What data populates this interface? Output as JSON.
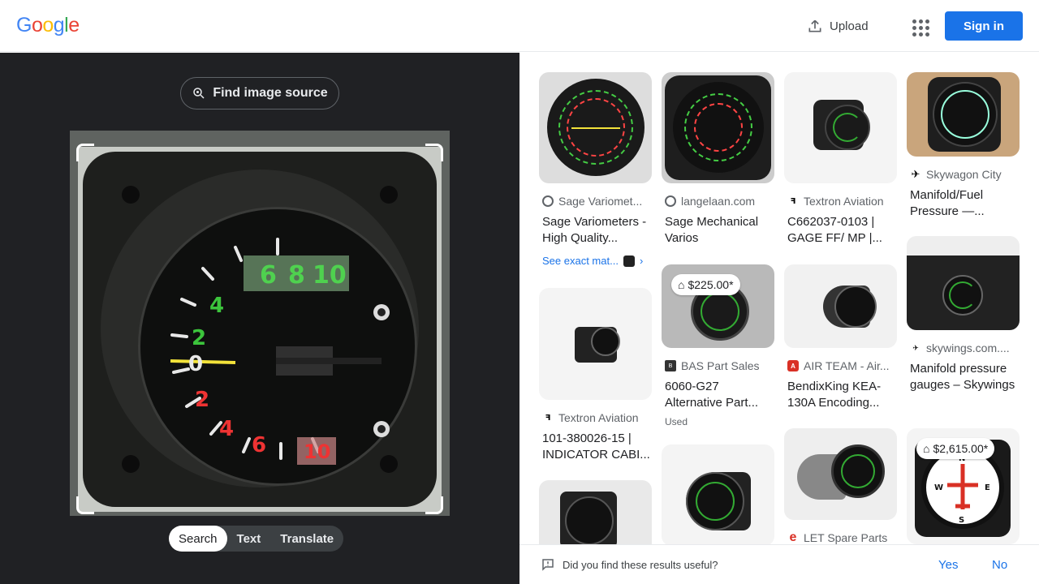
{
  "header": {
    "logo_letters": [
      "G",
      "o",
      "o",
      "g",
      "l",
      "e"
    ],
    "upload_label": "Upload",
    "signin_label": "Sign in"
  },
  "left": {
    "find_source_label": "Find image source",
    "chips": [
      "Search",
      "Text",
      "Translate"
    ],
    "active_chip": "Search"
  },
  "results": [
    {
      "source": "Sage Variomet...",
      "title": "Sage Variometers - High Quality...",
      "extra": "See exact mat..."
    },
    {
      "source": "langelaan.com",
      "title": "Sage Mechanical Varios"
    },
    {
      "source": "Textron Aviation",
      "title": "C662037-0103 | GAGE FF/ MP |..."
    },
    {
      "source": "Skywagon City",
      "title": "Manifold/Fuel Pressure —..."
    },
    {
      "source": "Textron Aviation",
      "title": "101-380026-15 | INDICATOR CABI..."
    },
    {
      "price": "$225.00*",
      "source": "BAS Part Sales",
      "title": "6060-G27 Alternative Part...",
      "extra": "Used"
    },
    {
      "source": "AIR TEAM - Air...",
      "title": "BendixKing KEA-130A Encoding..."
    },
    {
      "source": "skywings.com....",
      "title": "Manifold pressure gauges – Skywings"
    },
    {
      "source": "LET Spare Parts"
    },
    {
      "price": "$2,615.00*"
    }
  ],
  "feedback": {
    "question": "Did you find these results useful?",
    "yes": "Yes",
    "no": "No"
  },
  "colors": {
    "accent": "#1a73e8",
    "dark_pane": "#202124"
  }
}
